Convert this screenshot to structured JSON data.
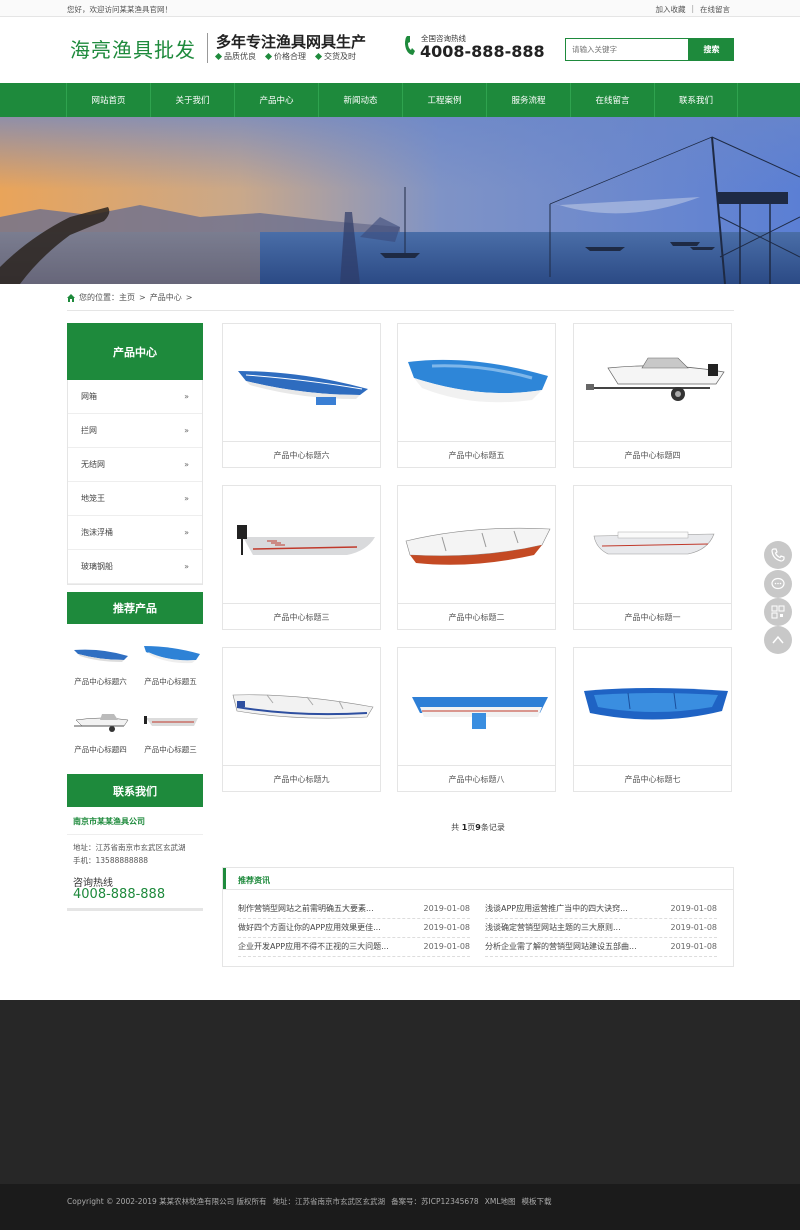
{
  "topbar": {
    "welcome": "您好，欢迎访问某某渔具官网！",
    "favorite": "加入收藏",
    "message": "在线留言"
  },
  "header": {
    "logo": "海亮渔具批发",
    "slogan": "多年专注渔具网具生产",
    "features": [
      "品质优良",
      "价格合理",
      "交货及时"
    ],
    "hotline_label": "全国咨询热线",
    "hotline": "4008-888-888",
    "search_placeholder": "请输入关键字",
    "search_button": "搜索"
  },
  "nav": {
    "items": [
      "网站首页",
      "关于我们",
      "产品中心",
      "新闻动态",
      "工程案例",
      "服务流程",
      "在线留言",
      "联系我们"
    ]
  },
  "breadcrumb": {
    "prefix": "您的位置：",
    "home": "主页",
    "sep1": ">",
    "current": "产品中心",
    "sep2": ">"
  },
  "sidebar": {
    "category_title": "产品中心",
    "categories": [
      "网箱",
      "拦网",
      "无结网",
      "地笼王",
      "泡沫浮桶",
      "玻璃钢船"
    ],
    "arrow": "»",
    "recommend_title": "推荐产品",
    "recommend": [
      "产品中心标题六",
      "产品中心标题五",
      "产品中心标题四",
      "产品中心标题三"
    ],
    "contact_title": "联系我们",
    "company": "南京市某某渔具公司",
    "address": "地址：江苏省南京市玄武区玄武湖",
    "mobile": "手机：13588888888",
    "hotline_label": "咨询热线",
    "hotline": "4008-888-888"
  },
  "products": [
    "产品中心标题六",
    "产品中心标题五",
    "产品中心标题四",
    "产品中心标题三",
    "产品中心标题二",
    "产品中心标题一",
    "产品中心标题九",
    "产品中心标题八",
    "产品中心标题七"
  ],
  "pager": {
    "prefix": "共 ",
    "pages": "1",
    "mid": "页",
    "records": "9",
    "suffix": "条记录"
  },
  "news": {
    "title": "推荐资讯",
    "left": [
      {
        "title": "制作营销型网站之前需明确五大要素...",
        "date": "2019-01-08"
      },
      {
        "title": "做好四个方面让你的APP应用效果更佳...",
        "date": "2019-01-08"
      },
      {
        "title": "企业开发APP应用不得不正视的三大问题...",
        "date": "2019-01-08"
      }
    ],
    "right": [
      {
        "title": "浅谈APP应用运营推广当中的四大诀窍...",
        "date": "2019-01-08"
      },
      {
        "title": "浅谈确定营销型网站主题的三大原则...",
        "date": "2019-01-08"
      },
      {
        "title": "分析企业需了解的营销型网站建设五部曲...",
        "date": "2019-01-08"
      }
    ]
  },
  "footer": {
    "copyright": "Copyright © 2002-2019 某某农林牧渔有限公司 版权所有",
    "address": "地址：江苏省南京市玄武区玄武湖",
    "icp": "备案号：苏ICP12345678",
    "xml": "XML地图",
    "template": "模板下载"
  },
  "colors": {
    "brand": "#1e8a3c",
    "footer": "#272727"
  }
}
